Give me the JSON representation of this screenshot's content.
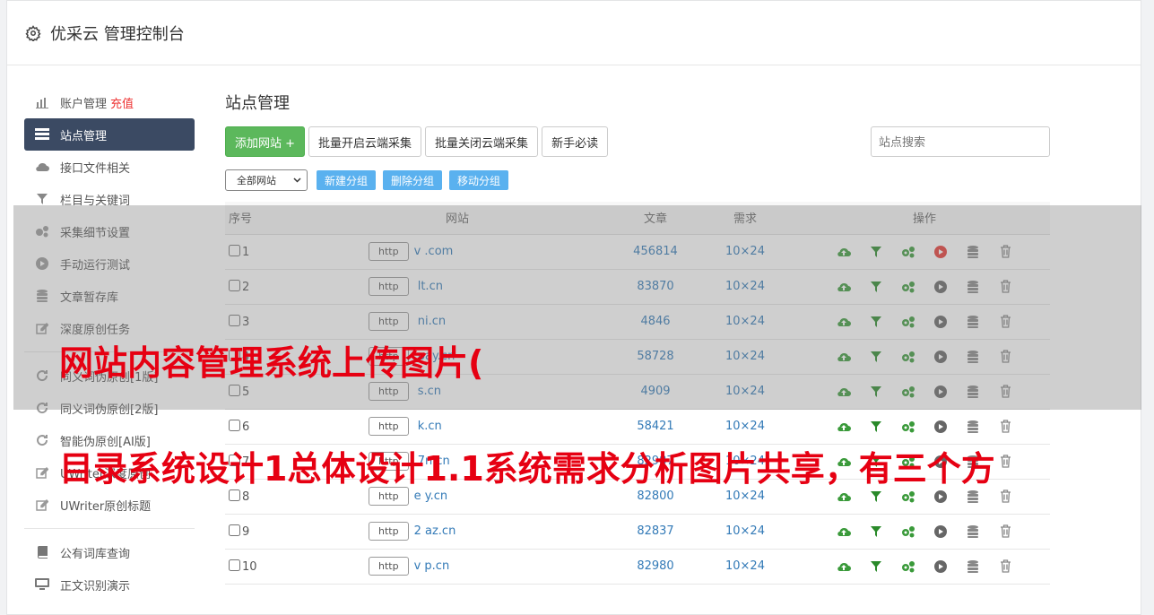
{
  "app": {
    "title": "优采云 管理控制台"
  },
  "sidebar": {
    "items": [
      {
        "label": "账户管理",
        "extra": "充值",
        "icon": "bar-chart-icon"
      },
      {
        "label": "站点管理",
        "icon": "server-icon",
        "active": true
      },
      {
        "label": "接口文件相关",
        "icon": "cloud-upload-icon"
      },
      {
        "label": "栏目与关键词",
        "icon": "filter-icon"
      },
      {
        "label": "采集细节设置",
        "icon": "gears-icon"
      },
      {
        "label": "手动运行测试",
        "icon": "play-icon"
      },
      {
        "label": "文章暂存库",
        "icon": "database-icon"
      },
      {
        "label": "深度原创任务",
        "icon": "edit-icon"
      },
      {
        "label": "同义词伪原创[1版]",
        "icon": "refresh-icon"
      },
      {
        "label": "同义词伪原创[2版]",
        "icon": "refresh-icon"
      },
      {
        "label": "智能伪原创[AI版]",
        "icon": "refresh-icon"
      },
      {
        "label": "UWriter深度原创",
        "icon": "edit-icon"
      },
      {
        "label": "UWriter原创标题",
        "icon": "edit-icon"
      },
      {
        "label": "公有词库查询",
        "icon": "book-icon"
      },
      {
        "label": "正文识别演示",
        "icon": "monitor-icon"
      }
    ]
  },
  "main": {
    "title": "站点管理",
    "buttons": {
      "add": "添加网站 +",
      "batch_open": "批量开启云端采集",
      "batch_close": "批量关闭云端采集",
      "guide": "新手必读"
    },
    "search_placeholder": "站点搜索",
    "group_select": "全部网站",
    "group_buttons": {
      "new": "新建分组",
      "delete": "删除分组",
      "move": "移动分组"
    },
    "table": {
      "headers": {
        "num": "序号",
        "site": "网站",
        "articles": "文章",
        "demand": "需求",
        "ops": "操作"
      },
      "rows": [
        {
          "num": "1",
          "http": "http",
          "domain": "v              .com",
          "articles": "456814",
          "demand": "10×24",
          "running": true
        },
        {
          "num": "2",
          "http": "http",
          "domain": "      lt.cn",
          "articles": "83870",
          "demand": "10×24"
        },
        {
          "num": "3",
          "http": "http",
          "domain": "      ni.cn",
          "articles": "4846",
          "demand": "10×24"
        },
        {
          "num": "4",
          "http": "http",
          "domain": "      pay.cn",
          "articles": "58728",
          "demand": "10×24"
        },
        {
          "num": "5",
          "http": "http",
          "domain": "      s.cn",
          "articles": "4909",
          "demand": "10×24"
        },
        {
          "num": "6",
          "http": "http",
          "domain": "      k.cn",
          "articles": "58421",
          "demand": "10×24"
        },
        {
          "num": "7",
          "http": "http",
          "domain": "      7n.cn",
          "articles": "82987",
          "demand": "10×24"
        },
        {
          "num": "8",
          "http": "http",
          "domain": "e      y.cn",
          "articles": "82800",
          "demand": "10×24"
        },
        {
          "num": "9",
          "http": "http",
          "domain": "2      az.cn",
          "articles": "82837",
          "demand": "10×24"
        },
        {
          "num": "10",
          "http": "http",
          "domain": "v      p.cn",
          "articles": "82980",
          "demand": "10×24"
        }
      ]
    }
  },
  "captions": {
    "line1": "网站内容管理系统上传图片(",
    "line2": "目录系统设计1总体设计1.1系统需求分析图片共享，有三个方"
  },
  "colors": {
    "sidebar_active": "#3b4a63",
    "add_button": "#5cb85c",
    "group_button": "#5ab1ef",
    "link": "#337ab7",
    "caption": "#e60012",
    "recharge": "#e33333"
  }
}
